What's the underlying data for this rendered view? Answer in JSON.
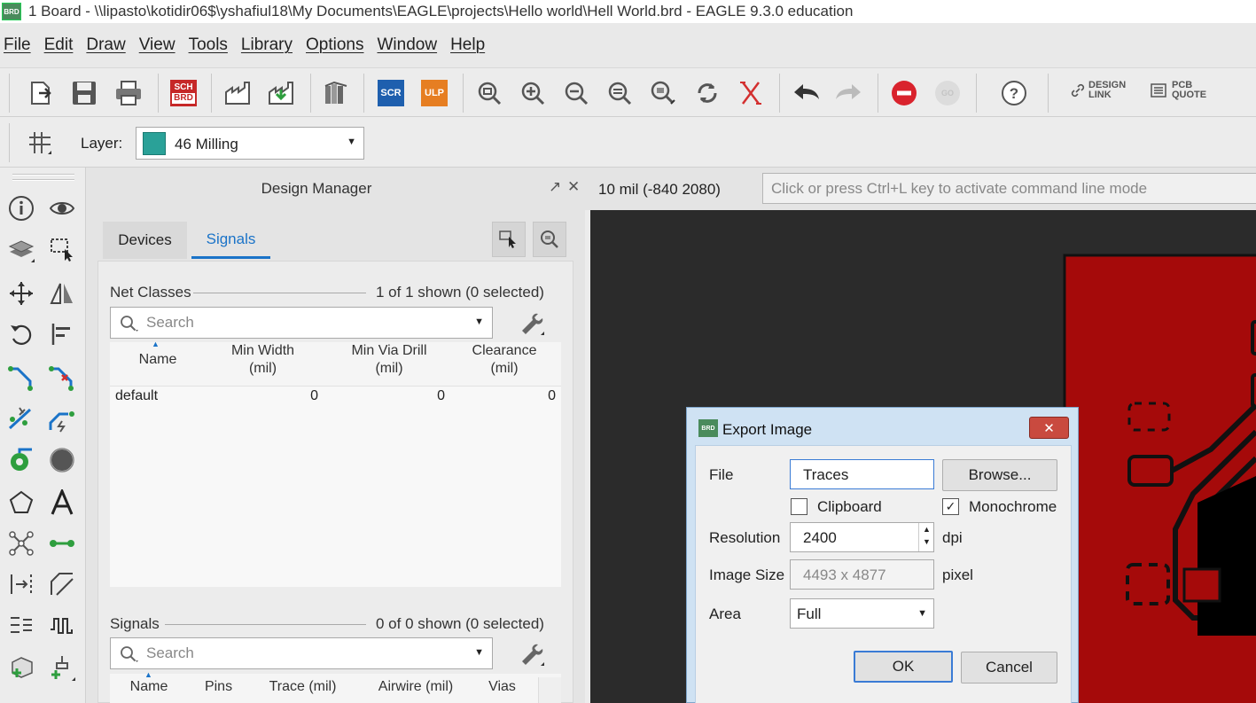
{
  "window": {
    "app_icon": "BRD",
    "title": "1 Board - \\\\lipasto\\kotidir06$\\yshafiul18\\My Documents\\EAGLE\\projects\\Hello world\\Hell World.brd - EAGLE 9.3.0 education"
  },
  "menu": [
    "File",
    "Edit",
    "Draw",
    "View",
    "Tools",
    "Library",
    "Options",
    "Window",
    "Help"
  ],
  "toolbar": {
    "sch_brd": [
      "SCH",
      "BRD"
    ],
    "scr": "SCR",
    "ulp": "ULP",
    "go": "GO",
    "design_link": [
      "DESIGN",
      "LINK"
    ],
    "pcb_quote": [
      "PCB",
      "QUOTE"
    ]
  },
  "layerbar": {
    "label": "Layer:",
    "value": "46 Milling",
    "color": "#2aa198"
  },
  "design_manager": {
    "title": "Design Manager",
    "tabs": [
      "Devices",
      "Signals"
    ],
    "active_tab": "Signals",
    "net_classes": {
      "label": "Net Classes",
      "count": "1 of 1 shown (0 selected)",
      "search_placeholder": "Search",
      "columns": [
        [
          "Name",
          ""
        ],
        [
          "Min Width",
          "(mil)"
        ],
        [
          "Min Via Drill",
          "(mil)"
        ],
        [
          "Clearance",
          "(mil)"
        ]
      ],
      "rows": [
        [
          "default",
          "0",
          "0",
          "0"
        ]
      ]
    },
    "signals": {
      "label": "Signals",
      "count": "0 of 0 shown (0 selected)",
      "search_placeholder": "Search",
      "columns": [
        "Name",
        "Pins",
        "Trace (mil)",
        "Airwire (mil)",
        "Vias"
      ]
    }
  },
  "status": {
    "coords": "10 mil (-840 2080)",
    "command_placeholder": "Click or press Ctrl+L key to activate command line mode"
  },
  "colors": {
    "board": "#a50a0a",
    "canvas": "#2b2b2b",
    "accent": "#1a73c8"
  },
  "export_dialog": {
    "icon": "BRD",
    "title": "Export Image",
    "file_label": "File",
    "file_value": "Traces",
    "browse": "Browse...",
    "clipboard_label": "Clipboard",
    "clipboard_checked": false,
    "monochrome_label": "Monochrome",
    "monochrome_checked": true,
    "resolution_label": "Resolution",
    "resolution_value": "2400",
    "resolution_unit": "dpi",
    "image_size_label": "Image Size",
    "image_size_value": "4493 x 4877",
    "image_size_unit": "pixel",
    "area_label": "Area",
    "area_value": "Full",
    "ok": "OK",
    "cancel": "Cancel"
  }
}
